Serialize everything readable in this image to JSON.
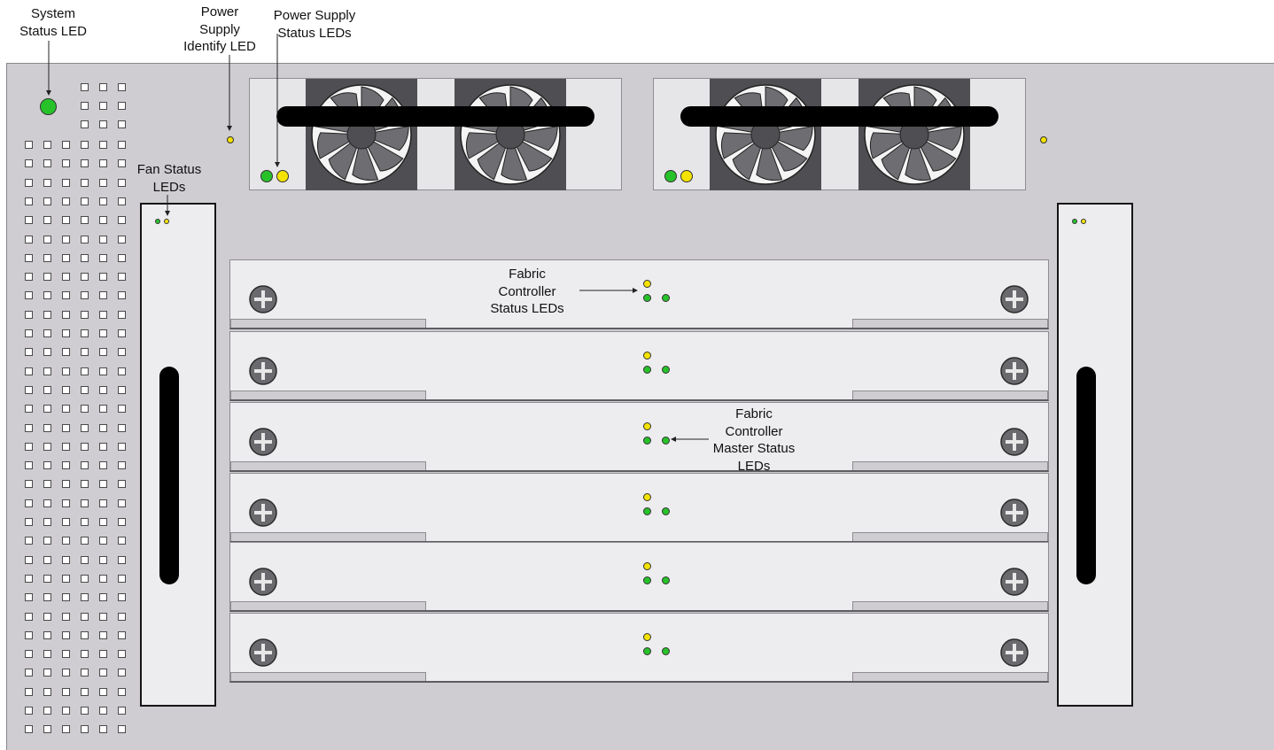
{
  "callouts": {
    "system_status_led": "System\nStatus LED",
    "power_supply_identify_led": "Power\nSupply\nIdentify LED",
    "power_supply_status_leds": "Power Supply\nStatus LEDs",
    "fan_status_leds": "Fan Status\nLEDs",
    "fabric_controller_status_leds": "Fabric\nController\nStatus LEDs",
    "fabric_controller_master_status_leds": "Fabric\nController\nMaster Status\nLEDs"
  },
  "colors": {
    "chassis": "#cfcdd2",
    "panel": "#edecef",
    "led_green": "#27c22a",
    "led_yellow": "#f4e300",
    "fan_housing": "#4f4e52"
  },
  "components": {
    "power_supply_count": 2,
    "fans_per_power_supply": 2,
    "fan_tray_count": 2,
    "fabric_controller_count": 6,
    "vent_columns": 6
  },
  "icons": {
    "fan": "fan-icon",
    "screw": "screw-icon",
    "led": "led-icon"
  }
}
